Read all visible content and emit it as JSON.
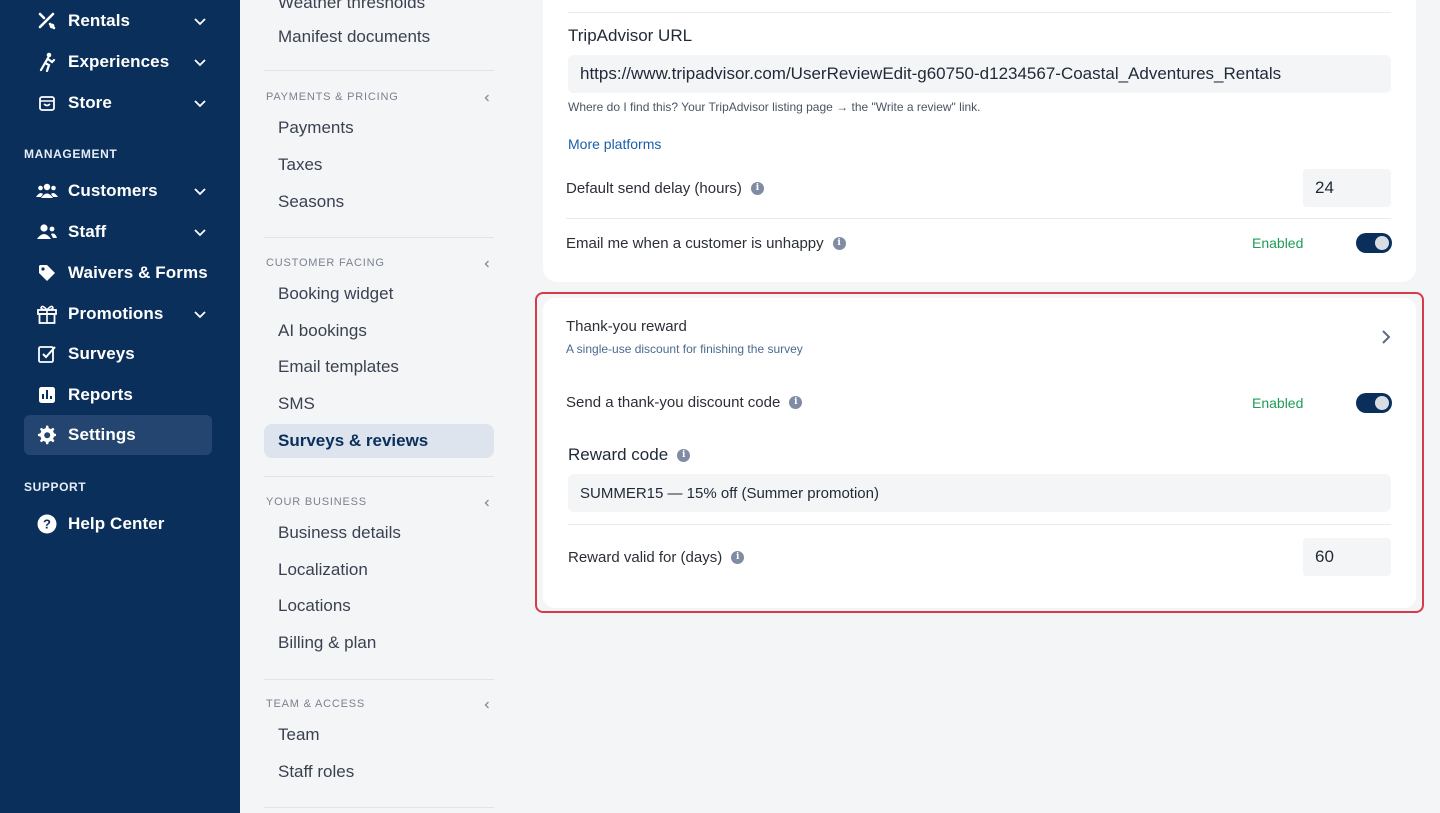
{
  "nav": {
    "items": [
      {
        "label": "Rentals",
        "icon": "rentals-icon",
        "has_chevron": true
      },
      {
        "label": "Experiences",
        "icon": "experiences-icon",
        "has_chevron": true
      },
      {
        "label": "Store",
        "icon": "store-icon",
        "has_chevron": true
      },
      {
        "label": "Customers",
        "icon": "customers-icon",
        "has_chevron": true
      },
      {
        "label": "Staff",
        "icon": "staff-icon",
        "has_chevron": true
      },
      {
        "label": "Waivers & Forms",
        "icon": "tag-icon",
        "has_chevron": false
      },
      {
        "label": "Promotions",
        "icon": "gift-icon",
        "has_chevron": true
      },
      {
        "label": "Surveys",
        "icon": "checkbox-icon",
        "has_chevron": false
      },
      {
        "label": "Reports",
        "icon": "reports-icon",
        "has_chevron": false
      },
      {
        "label": "Settings",
        "icon": "gear-icon",
        "has_chevron": false,
        "active": true
      },
      {
        "label": "Help Center",
        "icon": "help-icon",
        "has_chevron": false
      }
    ],
    "sections": {
      "management": "MANAGEMENT",
      "support": "SUPPORT"
    }
  },
  "submenu": {
    "top_items": [
      "Weather thresholds",
      "Manifest documents"
    ],
    "payments": {
      "title": "PAYMENTS & PRICING",
      "items": [
        "Payments",
        "Taxes",
        "Seasons"
      ]
    },
    "customer": {
      "title": "CUSTOMER FACING",
      "items": [
        "Booking widget",
        "AI bookings",
        "Email templates",
        "SMS",
        "Surveys & reviews"
      ]
    },
    "business": {
      "title": "YOUR BUSINESS",
      "items": [
        "Business details",
        "Localization",
        "Locations",
        "Billing & plan"
      ]
    },
    "team": {
      "title": "TEAM & ACCESS",
      "items": [
        "Team",
        "Staff roles"
      ]
    },
    "active": "Surveys & reviews"
  },
  "review_settings": {
    "tripadvisor_label": "TripAdvisor URL",
    "tripadvisor_value": "https://www.tripadvisor.com/UserReviewEdit-g60750-d1234567-Coastal_Adventures_Rentals",
    "tripadvisor_help": "Where do I find this? Your TripAdvisor listing page → the \"Write a review\" link.",
    "more_platforms": "More platforms",
    "delay_label": "Default send delay (hours)",
    "delay_value": "24",
    "unhappy_label": "Email me when a customer is unhappy",
    "unhappy_status": "Enabled",
    "unhappy_enabled": true
  },
  "reward": {
    "title": "Thank-you reward",
    "subtitle": "A single-use discount for finishing the survey",
    "send_label": "Send a thank-you discount code",
    "send_status": "Enabled",
    "send_enabled": true,
    "code_label": "Reward code",
    "code_value": "SUMMER15 — 15% off (Summer promotion)",
    "valid_label": "Reward valid for (days)",
    "valid_value": "60"
  },
  "colors": {
    "nav_bg": "#0b2f5b",
    "accent": "#1b5fa8",
    "enabled_green": "#1f9d55",
    "highlight_red": "#d83a4a"
  }
}
